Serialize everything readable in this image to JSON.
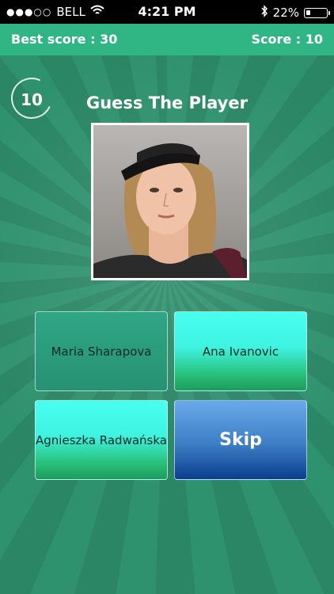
{
  "status_bar": {
    "carrier": "BELL",
    "signal": "●●●○○",
    "time": "4:21 PM",
    "battery_percent": "22%",
    "battery_level": 0.22,
    "icons": [
      "wifi-icon",
      "bluetooth-icon",
      "battery-icon"
    ]
  },
  "scores": {
    "best_label": "Best score : 30",
    "score_label": "Score : 10"
  },
  "timer": {
    "value": "10"
  },
  "game": {
    "title": "Guess The Player"
  },
  "answers": [
    {
      "label": "Maria Sharapova"
    },
    {
      "label": "Ana Ivanovic"
    },
    {
      "label": "Agnieszka Radwańska"
    }
  ],
  "skip_label": "Skip",
  "colors": {
    "background": "#2e8f6c",
    "score_bar": "#30b584",
    "answer_bright": "#48fff0",
    "skip_blue": "#3d7ec5"
  }
}
